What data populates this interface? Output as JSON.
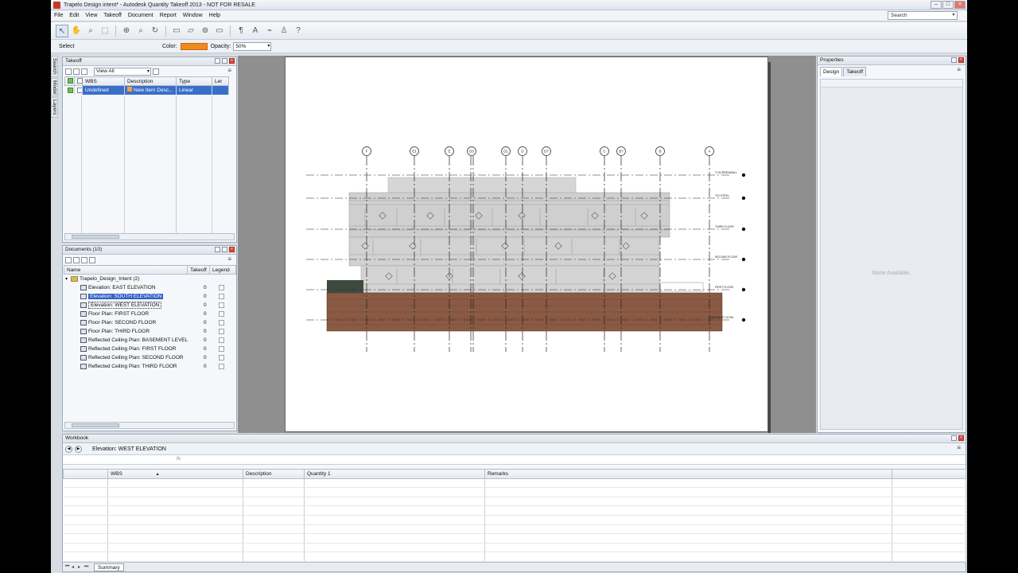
{
  "window": {
    "title": "Trapelo Design intent* - Autodesk Quantity Takeoff 2013 - NOT FOR RESALE"
  },
  "menu": [
    "File",
    "Edit",
    "View",
    "Takeoff",
    "Document",
    "Report",
    "Window",
    "Help"
  ],
  "search": {
    "placeholder": "Search"
  },
  "props_bar": {
    "tool": "Select",
    "color_label": "Color:",
    "color_value": "#f08a1d",
    "opacity_label": "Opacity:",
    "opacity_value": "50%"
  },
  "side_tabs": [
    "Search",
    "Model",
    "Layers"
  ],
  "takeoff": {
    "title": "Takeoff",
    "filter": "View All",
    "columns": [
      "WBS",
      "Description",
      "Type",
      "Ler"
    ],
    "rows": [
      {
        "wbs": "Undefined",
        "description": "New Item Desc...",
        "type": "Linear"
      }
    ]
  },
  "documents": {
    "title": "Documents (10)",
    "columns": [
      "Name",
      "Takeoff",
      "Legend"
    ],
    "folder": "Trapelo_Design_Intent (2)",
    "items": [
      {
        "name": "Elevation: EAST ELEVATION",
        "takeoff": "0"
      },
      {
        "name": "Elevation: SOUTH ELEVATION",
        "takeoff": "0"
      },
      {
        "name": "Elevation: WEST ELEVATION",
        "takeoff": "0"
      },
      {
        "name": "Floor Plan: FIRST FLOOR",
        "takeoff": "0"
      },
      {
        "name": "Floor Plan: SECOND FLOOR",
        "takeoff": "0"
      },
      {
        "name": "Floor Plan: THIRD FLOOR",
        "takeoff": "0"
      },
      {
        "name": "Reflected Ceiling Plan: BASEMENT LEVEL",
        "takeoff": "0"
      },
      {
        "name": "Reflected Ceiling Plan: FIRST FLOOR",
        "takeoff": "0"
      },
      {
        "name": "Reflected Ceiling Plan: SECOND FLOOR",
        "takeoff": "0"
      },
      {
        "name": "Reflected Ceiling Plan: THIRD FLOOR",
        "takeoff": "0"
      }
    ]
  },
  "drawing": {
    "grid_labels": [
      "F",
      "E1",
      "E",
      "D3",
      "D1",
      "D",
      "D7",
      "C",
      "B7",
      "B",
      "A"
    ],
    "level_labels": [
      "T/ SCREENWALL",
      "T/O STEEL",
      "THIRD FLOOR",
      "SECOND FLOOR",
      "FIRST FLOOR",
      "BASEMENT LEVEL"
    ]
  },
  "properties": {
    "title": "Properties",
    "tabs": [
      "Design",
      "Takeoff"
    ],
    "empty_text": "None Available."
  },
  "workbook": {
    "title": "Workbook",
    "document": "Elevation: WEST ELEVATION",
    "columns": [
      "WBS",
      "Description",
      "Quantity 1",
      "Remarks"
    ],
    "sheet_tab": "Summary"
  }
}
